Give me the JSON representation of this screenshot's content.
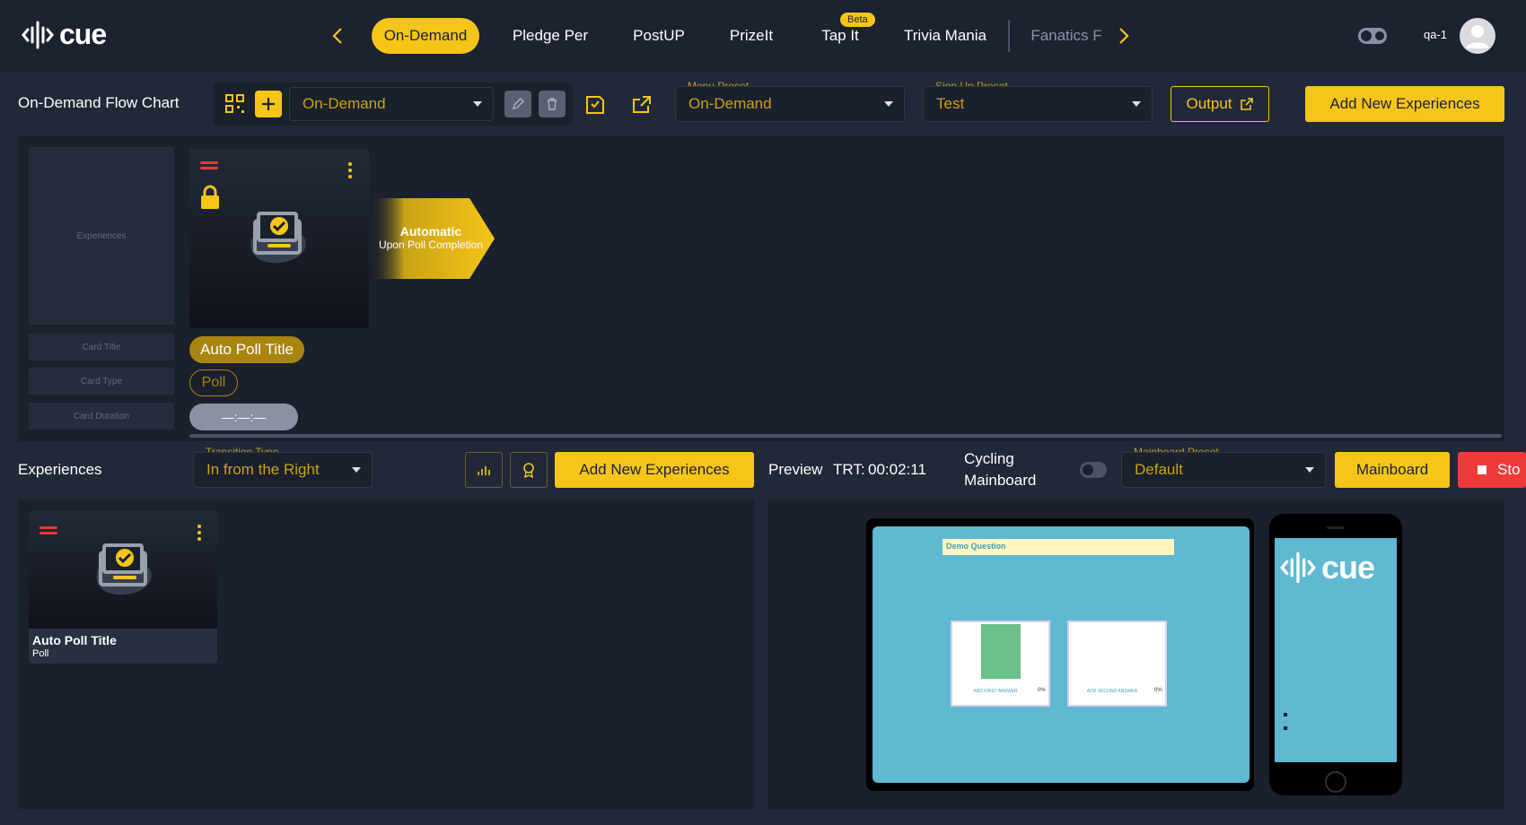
{
  "app": {
    "logo_text": "cue"
  },
  "nav": {
    "tabs": [
      {
        "label": "On-Demand"
      },
      {
        "label": "Pledge Per"
      },
      {
        "label": "PostUP"
      },
      {
        "label": "PrizeIt"
      },
      {
        "label": "Tap It"
      },
      {
        "label": "Trivia Mania"
      },
      {
        "label": "Fanatics F"
      }
    ],
    "beta_badge": "Beta",
    "user": "qa-1"
  },
  "toolbar": {
    "title": "On-Demand Flow Chart",
    "flow_select": "On-Demand",
    "menu_preset_label": "Menu Preset",
    "menu_preset_value": "On-Demand",
    "signup_preset_label": "Sign Up Preset",
    "signup_preset_value": "Test",
    "output_label": "Output",
    "add_label": "Add New Experiences"
  },
  "flowchart": {
    "legend": {
      "experiences": "Experiences",
      "card_title": "Card Title",
      "card_type": "Card Type",
      "card_duration": "Card Duration"
    },
    "card": {
      "title": "Auto Poll Title",
      "type": "Poll",
      "duration": "—:—:—"
    },
    "transition": {
      "title": "Automatic",
      "subtitle": "Upon Poll Completion"
    }
  },
  "experiences": {
    "title": "Experiences",
    "transition_type_label": "Transition Type",
    "transition_type_value": "In from the Right",
    "add_label": "Add New Experiences",
    "card": {
      "title": "Auto Poll Title",
      "type": "Poll"
    }
  },
  "preview": {
    "label": "Preview",
    "trt_label": "TRT:",
    "trt_value": "00:02:11",
    "cycling_label_1": "Cycling",
    "cycling_label_2": "Mainboard",
    "mainboard_preset_label": "Mainboard Preset",
    "mainboard_preset_value": "Default",
    "mainboard_button": "Mainboard",
    "stop_button": "Sto",
    "screen": {
      "question": "Demo Question",
      "answer1": "ADD FIRST ANSWER",
      "answer1_pct": "0%",
      "answer2": "ADD SECOND ANSWER",
      "answer2_pct": "0%"
    },
    "phone_logo": "cue"
  },
  "colors": {
    "accent": "#f5c518",
    "bg": "#212838",
    "panel": "#1a202c",
    "danger": "#f03a3a",
    "preview": "#5eb9d1"
  }
}
